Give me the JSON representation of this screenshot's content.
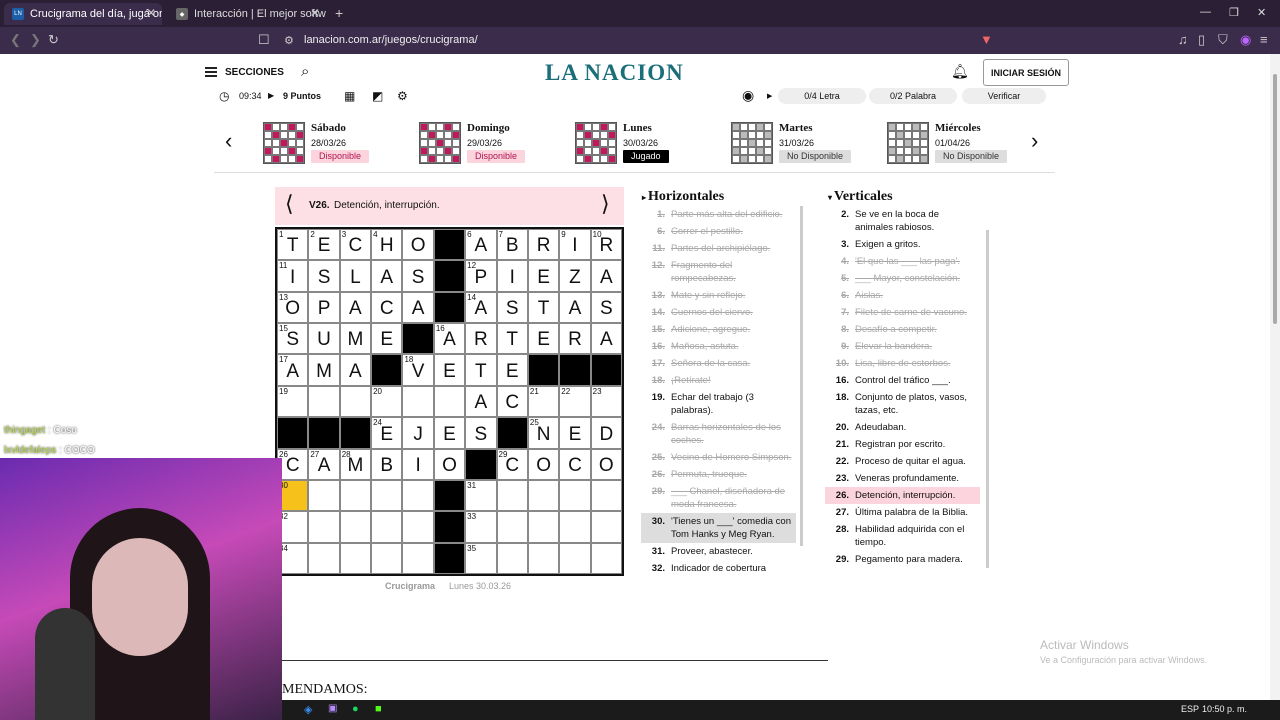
{
  "browser": {
    "tabs": [
      {
        "label": "Crucigrama del día, jugá online y",
        "icon": "LN"
      },
      {
        "label": "Interacción | El mejor software pa"
      }
    ],
    "url": "lanacion.com.ar/juegos/crucigrama/",
    "new_tab": "+"
  },
  "header": {
    "menu_label": "SECCIONES",
    "logo": "LA NACION",
    "login": "INICIAR SESIÓN"
  },
  "toolbar": {
    "time": "09:34",
    "points": "9 Puntos",
    "letter": "0/4 Letra",
    "word": "0/2 Palabra",
    "verify": "Verificar"
  },
  "days": [
    {
      "name": "Sábado",
      "date": "28/03/26",
      "status": "Disponible",
      "kind": "avail"
    },
    {
      "name": "Domingo",
      "date": "29/03/26",
      "status": "Disponible",
      "kind": "avail"
    },
    {
      "name": "Lunes",
      "date": "30/03/26",
      "status": "Jugado",
      "kind": "played"
    },
    {
      "name": "Martes",
      "date": "31/03/26",
      "status": "No Disponible",
      "kind": "na"
    },
    {
      "name": "Miércoles",
      "date": "01/04/26",
      "status": "No Disponible",
      "kind": "na"
    }
  ],
  "clue_bar": {
    "code": "V26.",
    "text": "Detención, interrupción."
  },
  "grid": [
    "TECHO#ABRIR",
    "ISLAS#PIEZA",
    "OPACA#ASTAS",
    "SUME#ARTERA",
    "AMA#VETE###",
    "......AC...",
    "###EJES#NED",
    "CAMBIO#COCO",
    ".....#.....",
    ".....#.....",
    ".....#....."
  ],
  "numbers": [
    [
      0,
      0,
      "1"
    ],
    [
      0,
      1,
      "2"
    ],
    [
      0,
      2,
      "3"
    ],
    [
      0,
      3,
      "4"
    ],
    [
      0,
      6,
      "6"
    ],
    [
      0,
      7,
      "7"
    ],
    [
      0,
      9,
      "9"
    ],
    [
      0,
      10,
      "10"
    ],
    [
      1,
      0,
      "11"
    ],
    [
      1,
      6,
      "12"
    ],
    [
      2,
      0,
      "13"
    ],
    [
      2,
      6,
      "14"
    ],
    [
      3,
      0,
      "15"
    ],
    [
      3,
      5,
      "16"
    ],
    [
      4,
      0,
      "17"
    ],
    [
      4,
      4,
      "18"
    ],
    [
      5,
      0,
      "19"
    ],
    [
      5,
      3,
      "20"
    ],
    [
      5,
      8,
      "21"
    ],
    [
      5,
      9,
      "22"
    ],
    [
      5,
      10,
      "23"
    ],
    [
      6,
      3,
      "24"
    ],
    [
      6,
      8,
      "25"
    ],
    [
      7,
      0,
      "26"
    ],
    [
      7,
      1,
      "27"
    ],
    [
      7,
      2,
      "28"
    ],
    [
      7,
      7,
      "29"
    ],
    [
      8,
      0,
      "30"
    ],
    [
      8,
      6,
      "31"
    ],
    [
      9,
      0,
      "32"
    ],
    [
      9,
      6,
      "33"
    ],
    [
      10,
      0,
      "34"
    ],
    [
      10,
      6,
      "35"
    ]
  ],
  "footer": {
    "brand": "Crucigrama",
    "date": "Lunes 30.03.26"
  },
  "horizontales": {
    "title": "Horizontales",
    "clues": [
      {
        "n": "1.",
        "t": "Parte más alta del edificio.",
        "d": true
      },
      {
        "n": "6.",
        "t": "Correr el pestillo.",
        "d": true
      },
      {
        "n": "11.",
        "t": "Partes del archipiélago.",
        "d": true
      },
      {
        "n": "12.",
        "t": "Fragmento del rompecabezas.",
        "d": true
      },
      {
        "n": "13.",
        "t": "Mate y sin reflejo.",
        "d": true
      },
      {
        "n": "14.",
        "t": "Cuernos del ciervo.",
        "d": true
      },
      {
        "n": "15.",
        "t": "Adicione, agregue.",
        "d": true
      },
      {
        "n": "16.",
        "t": "Mañosa, astuta.",
        "d": true
      },
      {
        "n": "17.",
        "t": "Señora de la casa.",
        "d": true
      },
      {
        "n": "18.",
        "t": "¡Retírate!",
        "d": true
      },
      {
        "n": "19.",
        "t": "Echar del trabajo (3 palabras).",
        "d": false
      },
      {
        "n": "24.",
        "t": "Barras horizontales de los coches.",
        "d": true
      },
      {
        "n": "25.",
        "t": "Vecino de Homero Simpson.",
        "d": true
      },
      {
        "n": "26.",
        "t": "Permuta, trueque.",
        "d": true
      },
      {
        "n": "29.",
        "t": "___ Chanel, diseñadora de moda francesa.",
        "d": true
      },
      {
        "n": "30.",
        "t": "'Tienes un ___' comedia con Tom Hanks y Meg Ryan.",
        "d": false,
        "h": true
      },
      {
        "n": "31.",
        "t": "Proveer, abastecer.",
        "d": false
      },
      {
        "n": "32.",
        "t": "Indicador de cobertura móvil.",
        "d": false
      }
    ]
  },
  "verticales": {
    "title": "Verticales",
    "clues": [
      {
        "n": "2.",
        "t": "Se ve en la boca de animales rabiosos.",
        "d": false
      },
      {
        "n": "3.",
        "t": "Exigen a gritos.",
        "d": false
      },
      {
        "n": "4.",
        "t": "'El que las ___ las paga'.",
        "d": true
      },
      {
        "n": "5.",
        "t": "___ Mayor, constelación.",
        "d": true
      },
      {
        "n": "6.",
        "t": "Aislas.",
        "d": true
      },
      {
        "n": "7.",
        "t": "Filete de carne de vacuno.",
        "d": true
      },
      {
        "n": "8.",
        "t": "Desafío a competir.",
        "d": true
      },
      {
        "n": "9.",
        "t": "Elevar la bandera.",
        "d": true
      },
      {
        "n": "10.",
        "t": "Lisa, libre de estorbos.",
        "d": true
      },
      {
        "n": "16.",
        "t": "Control del tráfico ___.",
        "d": false
      },
      {
        "n": "18.",
        "t": "Conjunto de platos, vasos, tazas, etc.",
        "d": false
      },
      {
        "n": "20.",
        "t": "Adeudaban.",
        "d": false
      },
      {
        "n": "21.",
        "t": "Registran por escrito.",
        "d": false
      },
      {
        "n": "22.",
        "t": "Proceso de quitar el agua.",
        "d": false
      },
      {
        "n": "23.",
        "t": "Veneras profundamente.",
        "d": false
      },
      {
        "n": "26.",
        "t": "Detención, interrupción.",
        "d": false,
        "s": true
      },
      {
        "n": "27.",
        "t": "Última palabra de la Biblia.",
        "d": false
      },
      {
        "n": "28.",
        "t": "Habilidad adquirida con el tiempo.",
        "d": false
      },
      {
        "n": "29.",
        "t": "Pegamento para madera.",
        "d": false
      }
    ]
  },
  "recommend": "MENDAMOS:",
  "chat": [
    {
      "user": "thingaget",
      "msg": "Coso"
    },
    {
      "user": "lxvldefaleps",
      "msg": "COCO"
    }
  ],
  "watermark": {
    "line1": "Activar Windows",
    "line2": "Ve a Configuración para activar Windows."
  },
  "taskbar": {
    "lang": "ESP",
    "time": "10:50 p. m."
  }
}
